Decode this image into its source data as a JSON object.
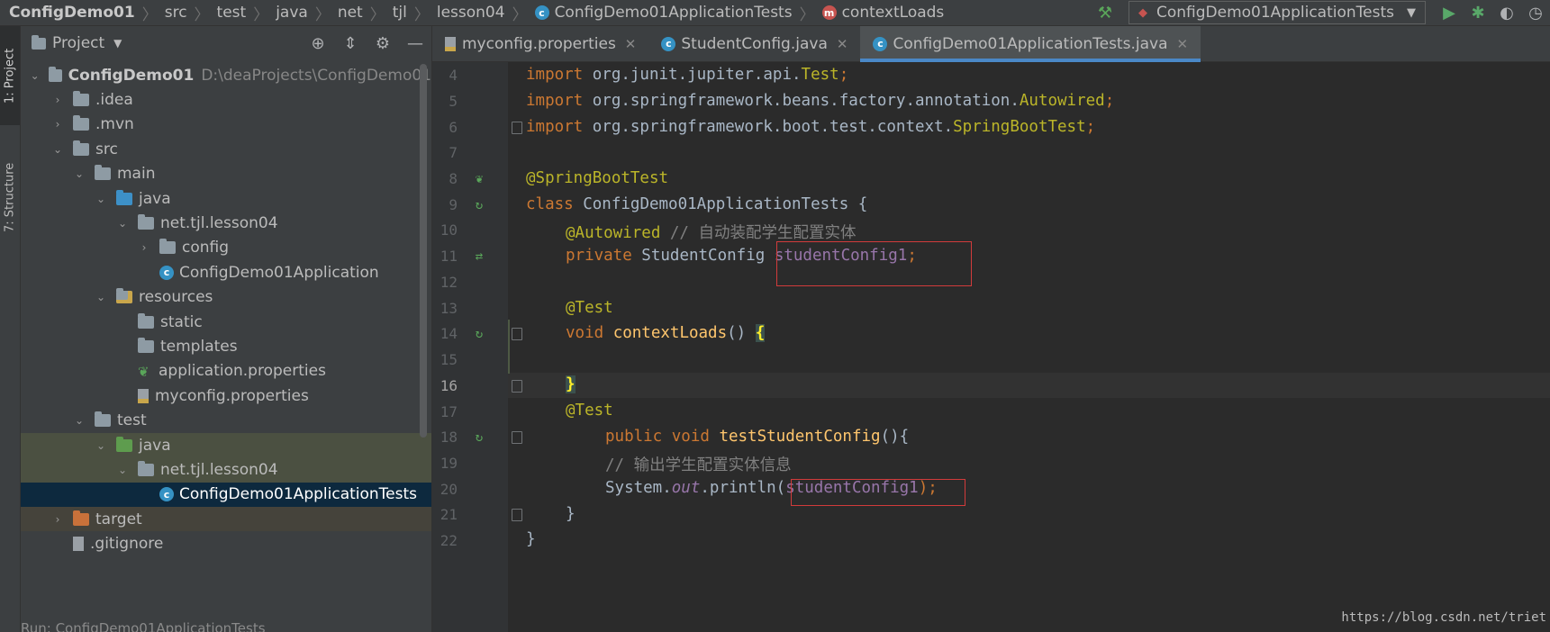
{
  "breadcrumb": [
    "ConfigDemo01",
    "src",
    "test",
    "java",
    "net",
    "tjl",
    "lesson04",
    "ConfigDemo01ApplicationTests",
    "contextLoads"
  ],
  "run_config": "ConfigDemo01ApplicationTests",
  "left_stripe": {
    "project_tab": "1: Project",
    "structure_tab": "7: Structure"
  },
  "project_panel": {
    "title": "Project",
    "tree": [
      {
        "label": "ConfigDemo01",
        "path": "D:\\deaProjects\\ConfigDemo01"
      },
      {
        "label": ".idea"
      },
      {
        "label": ".mvn"
      },
      {
        "label": "src"
      },
      {
        "label": "main"
      },
      {
        "label": "java"
      },
      {
        "label": "net.tjl.lesson04"
      },
      {
        "label": "config"
      },
      {
        "label": "ConfigDemo01Application"
      },
      {
        "label": "resources"
      },
      {
        "label": "static"
      },
      {
        "label": "templates"
      },
      {
        "label": "application.properties"
      },
      {
        "label": "myconfig.properties"
      },
      {
        "label": "test"
      },
      {
        "label": "java"
      },
      {
        "label": "net.tjl.lesson04"
      },
      {
        "label": "ConfigDemo01ApplicationTests"
      },
      {
        "label": "target"
      },
      {
        "label": ".gitignore"
      }
    ]
  },
  "tabs": [
    {
      "label": "myconfig.properties"
    },
    {
      "label": "StudentConfig.java"
    },
    {
      "label": "ConfigDemo01ApplicationTests.java"
    }
  ],
  "editor": {
    "line_numbers": [
      "4",
      "5",
      "6",
      "7",
      "8",
      "9",
      "10",
      "11",
      "12",
      "13",
      "14",
      "15",
      "16",
      "17",
      "18",
      "19",
      "20",
      "21",
      "22"
    ],
    "code": {
      "l4_kw": "import",
      "l4_pkg": " org.junit.jupiter.api.",
      "l4_cls": "Test",
      "l4_end": ";",
      "l5_kw": "import",
      "l5_pkg": " org.springframework.beans.factory.annotation.",
      "l5_cls": "Autowired",
      "l5_end": ";",
      "l6_kw": "import",
      "l6_pkg": " org.springframework.boot.test.context.",
      "l6_cls": "SpringBootTest",
      "l6_end": ";",
      "l8_ann": "@SpringBootTest",
      "l9_kw": "class",
      "l9_rest": " ConfigDemo01ApplicationTests {",
      "l10_ann": "@Autowired",
      "l10_cmt": " // 自动装配学生配置实体",
      "l11_kw": "private",
      "l11_type": " StudentConfig ",
      "l11_fld": "studentConfig1",
      "l11_end": ";",
      "l13_ann": "@Test",
      "l14_kw": "void",
      "l14_mth": " contextLoads",
      "l14_rest": "() ",
      "l14_brace": "{",
      "l16_brace": "}",
      "l17_ann": "@Test",
      "l18_kw": "public void",
      "l18_mth": " testStudentConfig",
      "l18_rest": "(){",
      "l19_cmt": "// 输出学生配置实体信息",
      "l20_sys": "System.",
      "l20_out": "out",
      "l20_mid": ".println(",
      "l20_fld": "studentConfig1",
      "l20_end": ");",
      "l21": "}",
      "l22": "}"
    }
  },
  "watermark": "https://blog.csdn.net/triet",
  "statusbar": "Run: ConfigDemo01ApplicationTests"
}
